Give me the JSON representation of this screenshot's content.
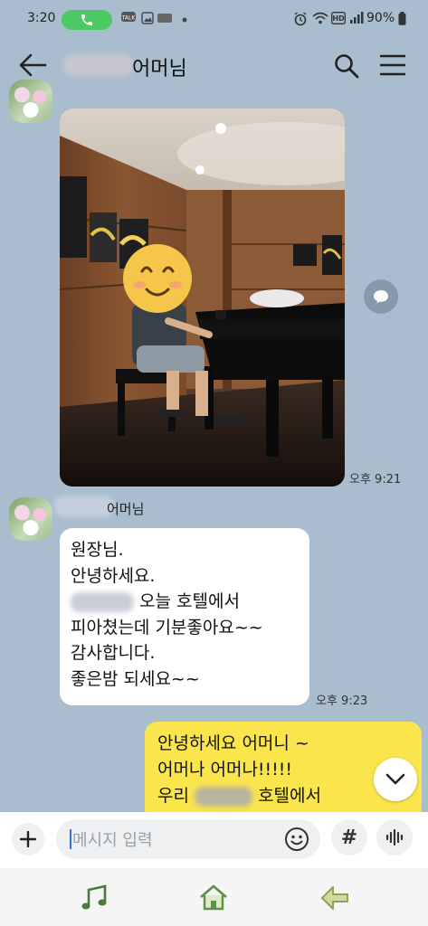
{
  "status_bar": {
    "time": "3:20",
    "battery": "90%"
  },
  "header": {
    "title": "어머님"
  },
  "photo_message": {
    "time": "오후 9:21"
  },
  "incoming": {
    "sender": "어머님",
    "lines": [
      "원장님.",
      "안녕하세요.",
      "오늘 호텔에서",
      "피아쳤는데 기분좋아요~~",
      "감사합니다.",
      "좋은밤 되세요~~"
    ],
    "time": "오후 9:23"
  },
  "outgoing": {
    "lines": [
      "안녕하세요 어머니 ~",
      "어머나 어머나!!!!!",
      "우리",
      "호텔에서"
    ]
  },
  "input": {
    "placeholder": "메시지 입력",
    "hash_label": "#"
  },
  "colors": {
    "chat_background": "#a9bdcf",
    "outgoing_bubble": "#fae54d",
    "incoming_bubble": "#ffffff",
    "call_pill": "#4cc864"
  },
  "icons": [
    "back-arrow-icon",
    "search-icon",
    "menu-icon",
    "share-icon",
    "chevron-down-icon",
    "plus-icon",
    "emoji-icon",
    "hash-icon",
    "voice-icon",
    "music-note-icon",
    "home-icon",
    "back-icon",
    "phone-icon"
  ]
}
